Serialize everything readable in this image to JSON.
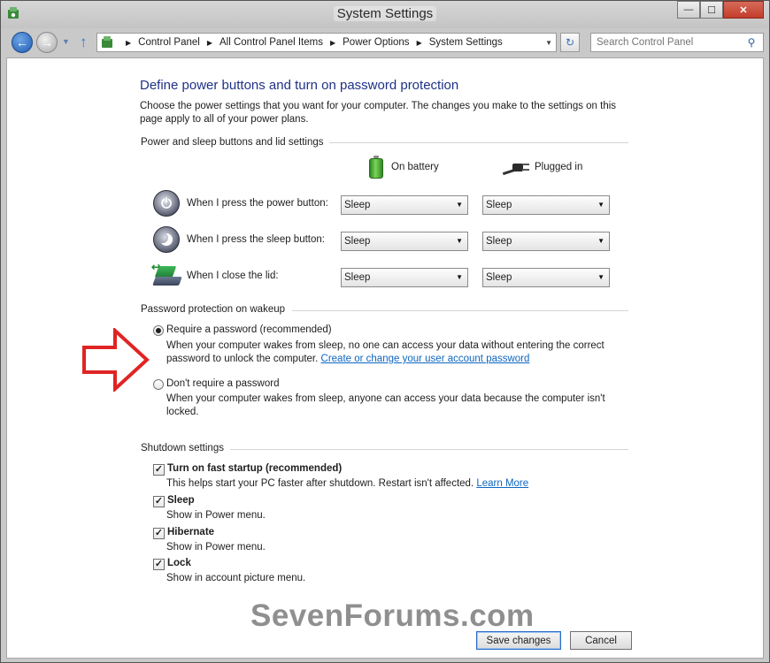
{
  "window": {
    "title": "System Settings",
    "minimize": "—",
    "maximize": "☐",
    "close": "✕"
  },
  "nav": {
    "back": "←",
    "forward": "→",
    "recent": "▼",
    "up": "↑",
    "breadcrumbs": [
      "Control Panel",
      "All Control Panel Items",
      "Power Options",
      "System Settings"
    ],
    "breadcrumb_sep": "▶",
    "address_dropdown": "▼",
    "refresh": "↻",
    "search_placeholder": "Search Control Panel",
    "search_glyph": "⚲"
  },
  "page": {
    "heading": "Define power buttons and turn on password protection",
    "intro": "Choose the power settings that you want for your computer. The changes you make to the settings on this page apply to all of your power plans."
  },
  "power_section": {
    "title": "Power and sleep buttons and lid settings",
    "col_battery": "On battery",
    "col_plugged": "Plugged in",
    "power_glyph": "⏻",
    "lid_glyph": "↩",
    "rows": [
      {
        "label": "When I press the power button:",
        "battery": "Sleep",
        "plugged": "Sleep"
      },
      {
        "label": "When I press the sleep button:",
        "battery": "Sleep",
        "plugged": "Sleep"
      },
      {
        "label": "When I close the lid:",
        "battery": "Sleep",
        "plugged": "Sleep"
      }
    ],
    "caret": "▼"
  },
  "password_section": {
    "title": "Password protection on wakeup",
    "require_label": "Require a password (recommended)",
    "require_desc": "When your computer wakes from sleep, no one can access your data without entering the correct password to unlock the computer.",
    "require_link": "Create or change your user account password",
    "dont_label": "Don't require a password",
    "dont_desc": "When your computer wakes from sleep, anyone can access your data because the computer isn't locked.",
    "selected": "require"
  },
  "shutdown_section": {
    "title": "Shutdown settings",
    "check_glyph": "✓",
    "items": [
      {
        "label": "Turn on fast startup (recommended)",
        "desc": "This helps start your PC faster after shutdown. Restart isn't affected.",
        "link": "Learn More",
        "checked": true
      },
      {
        "label": "Sleep",
        "desc": "Show in Power menu.",
        "checked": true
      },
      {
        "label": "Hibernate",
        "desc": "Show in Power menu.",
        "checked": true
      },
      {
        "label": "Lock",
        "desc": "Show in account picture menu.",
        "checked": true
      }
    ]
  },
  "watermark": "SevenForums.com",
  "buttons": {
    "save": "Save changes",
    "cancel": "Cancel"
  },
  "colors": {
    "heading": "#1e3287",
    "link": "#0e66c0",
    "arrow": "#e02424"
  }
}
